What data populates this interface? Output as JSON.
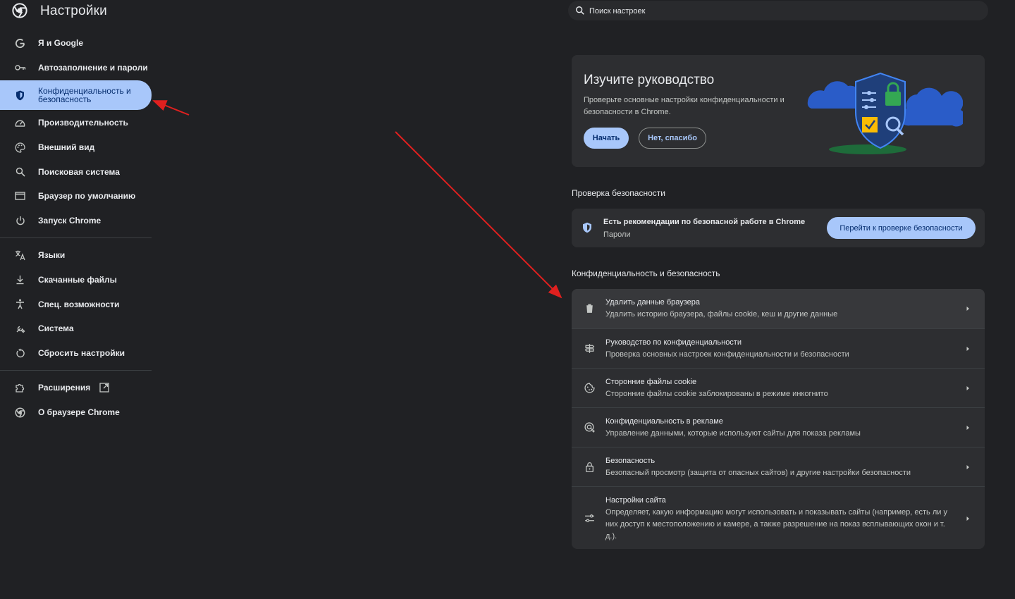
{
  "header": {
    "title": "Настройки",
    "search_placeholder": "Поиск настроек"
  },
  "sidebar": {
    "items": [
      {
        "label": "Я и Google",
        "icon": "google-icon"
      },
      {
        "label": "Автозаполнение и пароли",
        "icon": "key-icon"
      },
      {
        "label": "Конфиденциальность и безопасность",
        "icon": "shield-icon",
        "active": true
      },
      {
        "label": "Производительность",
        "icon": "speedometer-icon"
      },
      {
        "label": "Внешний вид",
        "icon": "palette-icon"
      },
      {
        "label": "Поисковая система",
        "icon": "search-icon"
      },
      {
        "label": "Браузер по умолчанию",
        "icon": "browser-window-icon"
      },
      {
        "label": "Запуск Chrome",
        "icon": "power-icon"
      },
      {
        "label": "Языки",
        "icon": "translate-icon"
      },
      {
        "label": "Скачанные файлы",
        "icon": "download-icon"
      },
      {
        "label": "Спец. возможности",
        "icon": "accessibility-icon"
      },
      {
        "label": "Система",
        "icon": "wrench-icon"
      },
      {
        "label": "Сбросить настройки",
        "icon": "reset-icon"
      },
      {
        "label": "Расширения",
        "icon": "puzzle-icon"
      },
      {
        "label": "О браузере Chrome",
        "icon": "chrome-icon"
      }
    ]
  },
  "guide": {
    "title": "Изучите руководство",
    "description": "Проверьте основные настройки конфиденциальности и безопасности в Chrome.",
    "start_label": "Начать",
    "decline_label": "Нет, спасибо"
  },
  "safety_check": {
    "section_title": "Проверка безопасности",
    "title": "Есть рекомендации по безопасной работе в Chrome",
    "subtitle": "Пароли",
    "button_label": "Перейти к проверке безопасности"
  },
  "privacy": {
    "section_title": "Конфиденциальность и безопасность",
    "rows": [
      {
        "title": "Удалить данные браузера",
        "subtitle": "Удалить историю браузера, файлы cookie, кеш и другие данные",
        "icon": "trash-icon"
      },
      {
        "title": "Руководство по конфиденциальности",
        "subtitle": "Проверка основных настроек конфиденциальности и безопасности",
        "icon": "signpost-icon"
      },
      {
        "title": "Сторонние файлы cookie",
        "subtitle": "Сторонние файлы cookie заблокированы в режиме инкогнито",
        "icon": "cookie-icon"
      },
      {
        "title": "Конфиденциальность в рекламе",
        "subtitle": "Управление данными, которые используют сайты для показа рекламы",
        "icon": "ad-privacy-icon"
      },
      {
        "title": "Безопасность",
        "subtitle": "Безопасный просмотр (защита от опасных сайтов) и другие настройки безопасности",
        "icon": "lock-icon"
      },
      {
        "title": "Настройки сайта",
        "subtitle": "Определяет, какую информацию могут использовать и показывать сайты (например, есть ли у них доступ к местоположению и камере, а также разрешение на показ всплывающих окон и т. д.).",
        "icon": "tune-icon"
      }
    ]
  },
  "colors": {
    "background": "#202124",
    "card": "#2d2e31",
    "accent": "#a8c7fa",
    "annotation_arrow": "#e0201f"
  }
}
